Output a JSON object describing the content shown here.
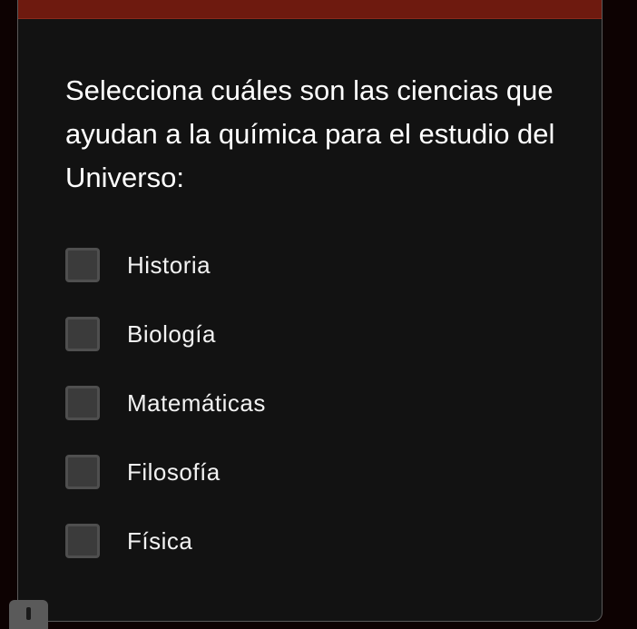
{
  "question": {
    "text": "Selecciona cuáles son las ciencias que ayudan a la química para el estudio del Universo:"
  },
  "options": [
    {
      "label": "Historia",
      "checked": false
    },
    {
      "label": "Biología",
      "checked": false
    },
    {
      "label": "Matemáticas",
      "checked": false
    },
    {
      "label": "Filosofía",
      "checked": false
    },
    {
      "label": "Física",
      "checked": false
    }
  ],
  "colors": {
    "header_bar": "#6e1a0f",
    "card_background": "#121212",
    "checkbox_fill": "#3b3b3b"
  },
  "icons": {
    "feedback": "exclamation-icon"
  }
}
